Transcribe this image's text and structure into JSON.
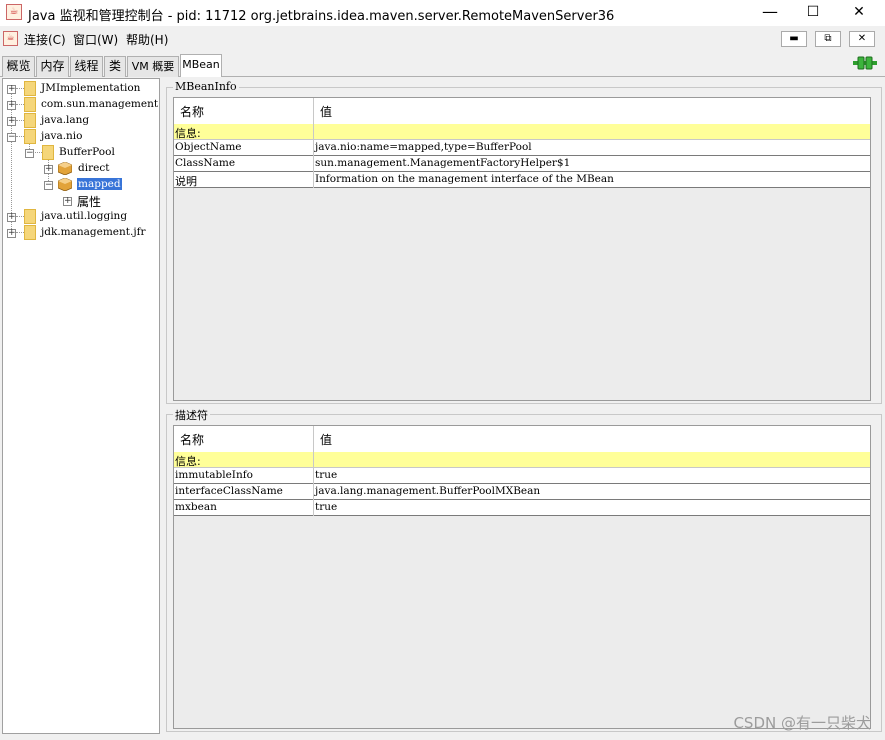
{
  "window": {
    "title": "Java 监视和管理控制台 - pid: 11712 org.jetbrains.idea.maven.server.RemoteMavenServer36",
    "minimize": "—",
    "maximize": "☐",
    "close": "✕"
  },
  "menu": {
    "items": [
      "连接(C)",
      "窗口(W)",
      "帮助(H)"
    ],
    "mdi_buttons": [
      "▬",
      "⧉",
      "✕"
    ]
  },
  "tabs": [
    {
      "label": "概览"
    },
    {
      "label": "内存"
    },
    {
      "label": "线程"
    },
    {
      "label": "类"
    },
    {
      "label": "VM 概要"
    },
    {
      "label": "MBean",
      "active": true
    }
  ],
  "tree": {
    "nodes": [
      {
        "label": "JMImplementation",
        "expander": "+"
      },
      {
        "label": "com.sun.management",
        "expander": "+"
      },
      {
        "label": "java.lang",
        "expander": "+"
      },
      {
        "label": "java.nio",
        "expander": "−"
      },
      {
        "label": "BufferPool",
        "expander": "−"
      },
      {
        "label": "direct",
        "expander": "+"
      },
      {
        "label": "mapped",
        "expander": "−",
        "selected": true
      },
      {
        "label": "属性",
        "expander": "+"
      },
      {
        "label": "java.util.logging",
        "expander": "+"
      },
      {
        "label": "jdk.management.jfr",
        "expander": "+"
      }
    ]
  },
  "mbeaninfo": {
    "title": "MBeanInfo",
    "headers": [
      "名称",
      "值"
    ],
    "rows": [
      {
        "name": "信息:",
        "value": "",
        "highlight": true
      },
      {
        "name": "ObjectName",
        "value": "java.nio:name=mapped,type=BufferPool"
      },
      {
        "name": "ClassName",
        "value": "sun.management.ManagementFactoryHelper$1"
      },
      {
        "name": "说明",
        "value": "Information on the management interface of the MBean"
      }
    ]
  },
  "descriptor": {
    "title": "描述符",
    "headers": [
      "名称",
      "值"
    ],
    "rows": [
      {
        "name": "信息:",
        "value": "",
        "highlight": true
      },
      {
        "name": "immutableInfo",
        "value": "true"
      },
      {
        "name": "interfaceClassName",
        "value": "java.lang.management.BufferPoolMXBean"
      },
      {
        "name": "mxbean",
        "value": "true"
      }
    ]
  },
  "watermark": "CSDN @有一只柴犬",
  "colors": {
    "highlight_row": "#ffff99",
    "selection": "#3874d8",
    "folder": "#f5d67a",
    "connected": "#2e9e2e"
  }
}
